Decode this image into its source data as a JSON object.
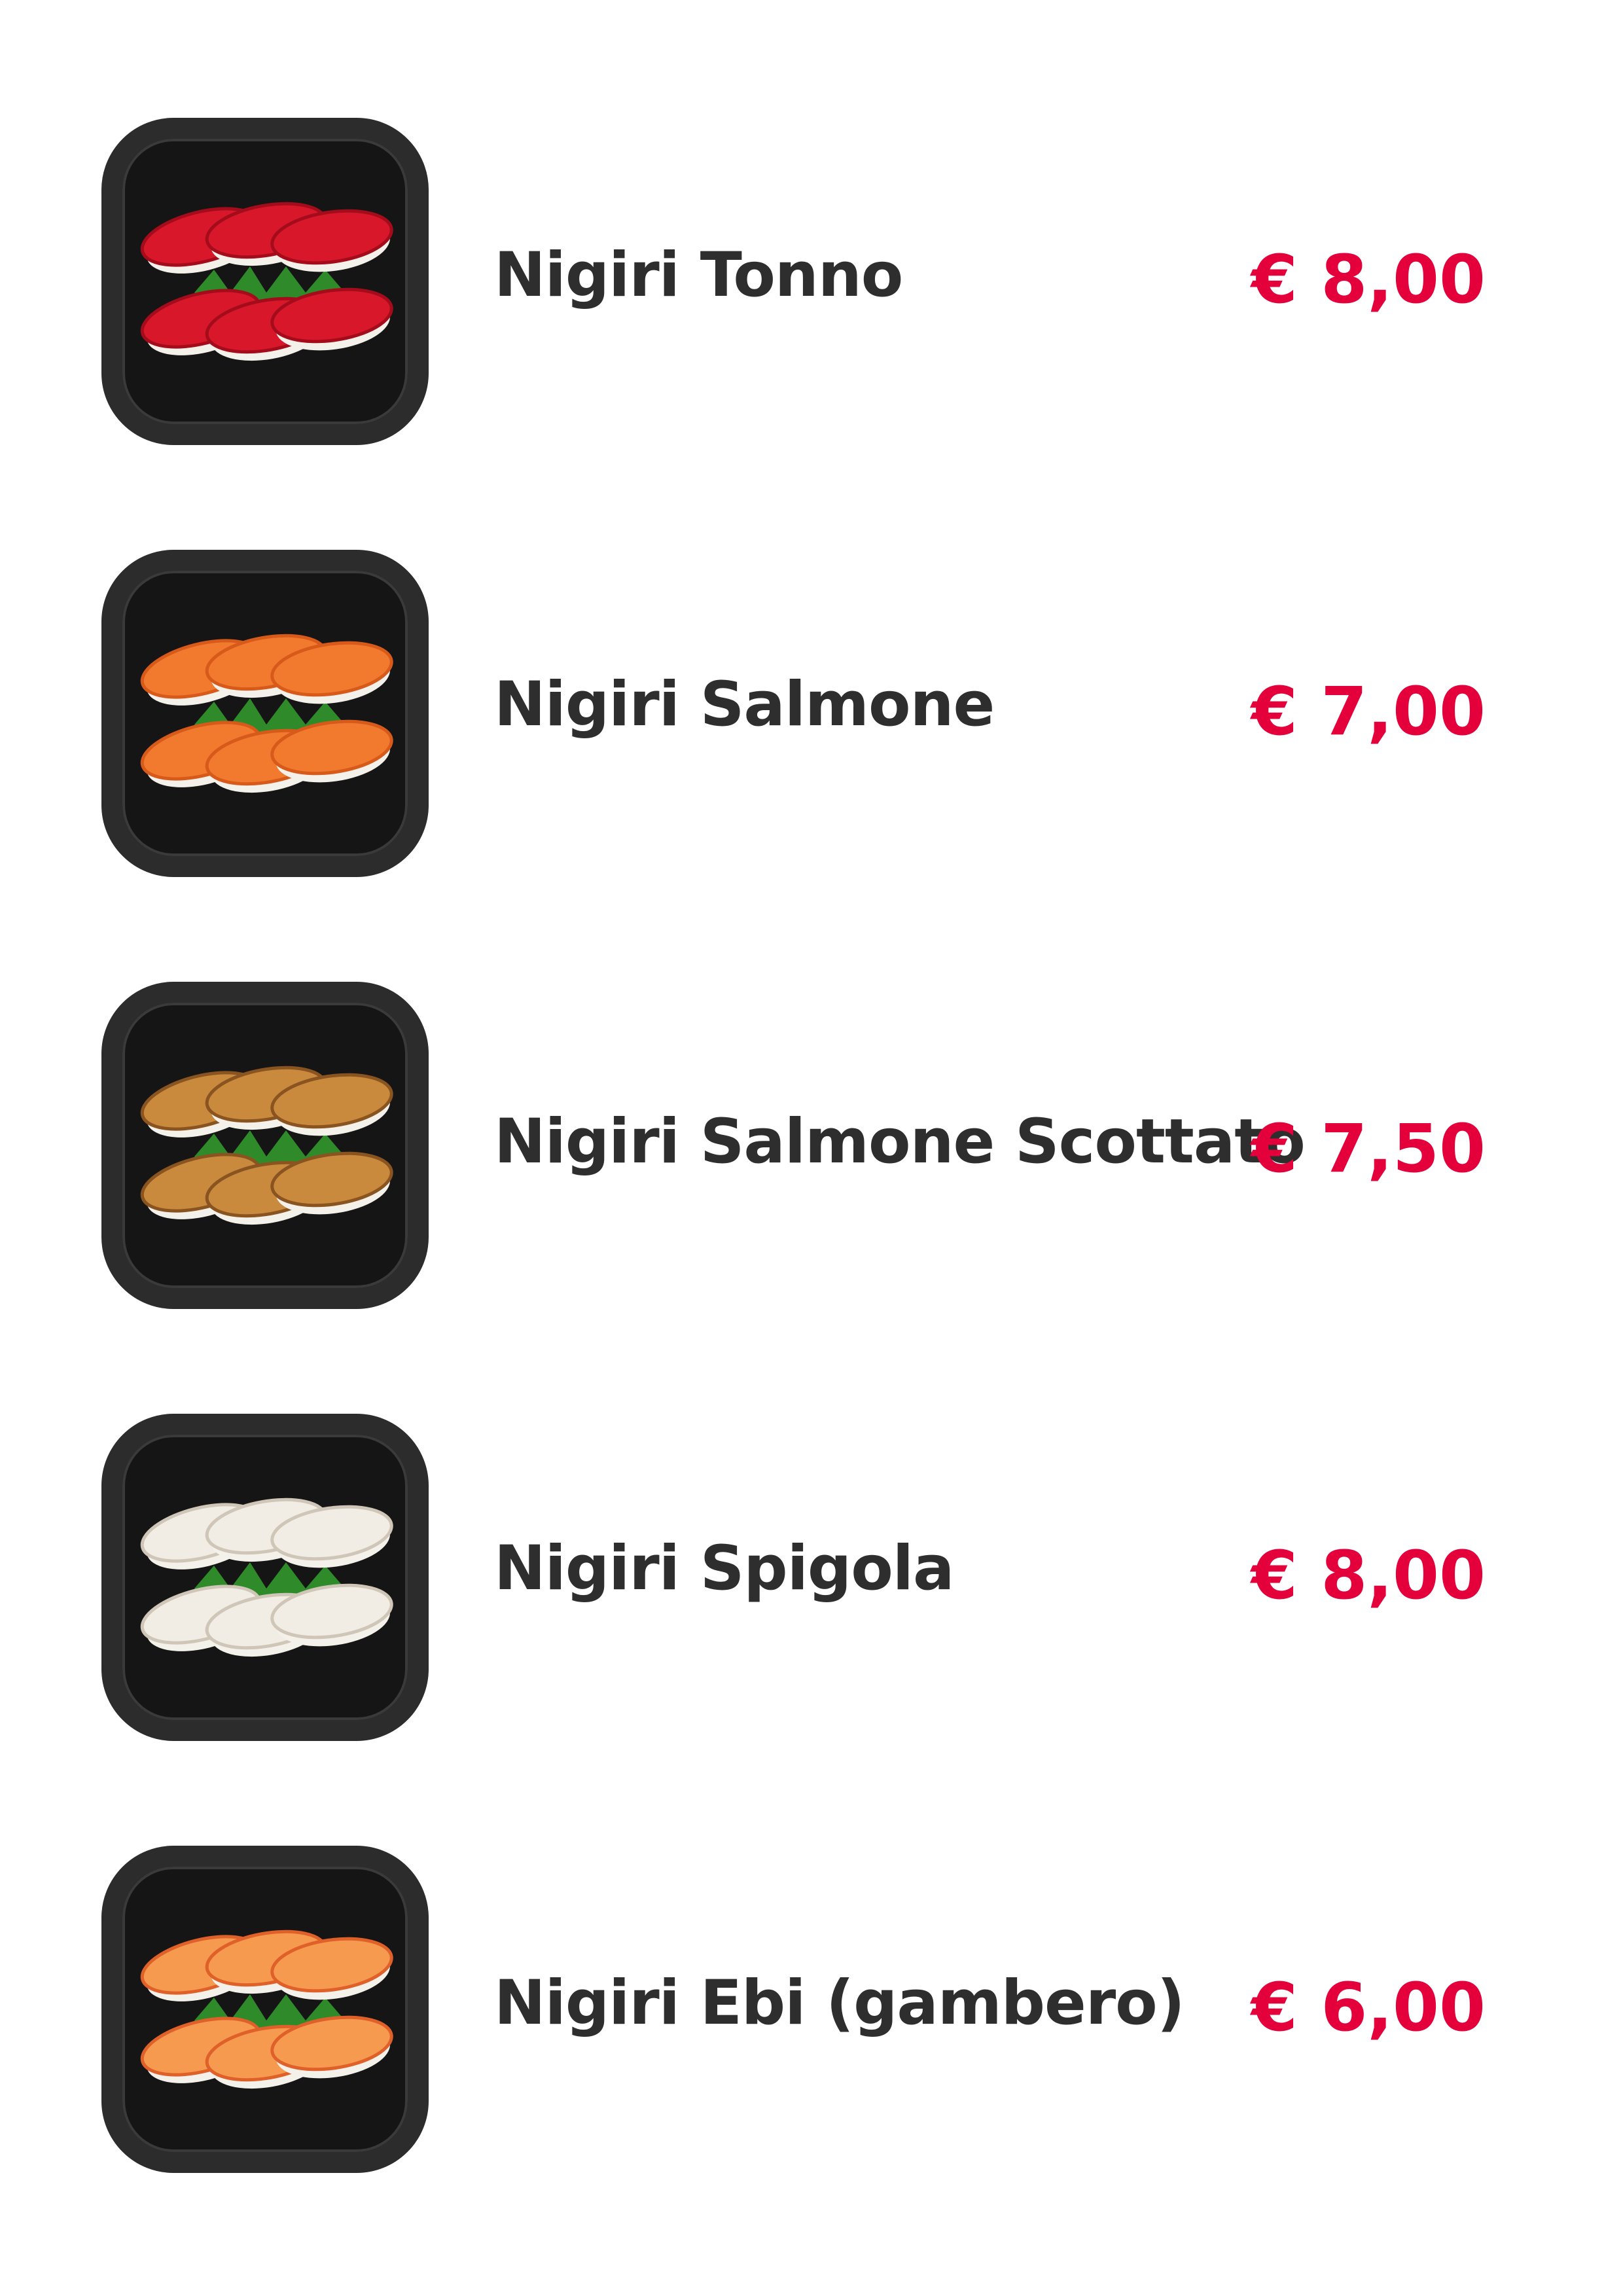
{
  "currency_color": "#e4003a",
  "name_color": "#2e2e2e",
  "items": [
    {
      "name": "Nigiri Tonno",
      "price": "€ 8,00",
      "image": "tuna-nigiri-image",
      "fish_color": "#d8182a",
      "fish_shade": "#a50c1b"
    },
    {
      "name": "Nigiri Salmone",
      "price": "€ 7,00",
      "image": "salmon-nigiri-image",
      "fish_color": "#f27a2e",
      "fish_shade": "#d85a1a"
    },
    {
      "name": "Nigiri Salmone Scottato",
      "price": "€ 7,50",
      "image": "seared-salmon-nigiri-image",
      "fish_color": "#c98a3e",
      "fish_shade": "#8a5420"
    },
    {
      "name": "Nigiri Spigola",
      "price": "€ 8,00",
      "image": "sea-bass-nigiri-image",
      "fish_color": "#f1ece4",
      "fish_shade": "#cfc6b8"
    },
    {
      "name": "Nigiri Ebi (gambero)",
      "price": "€ 6,00",
      "image": "shrimp-nigiri-image",
      "fish_color": "#f59a4e",
      "fish_shade": "#e0602a"
    }
  ]
}
